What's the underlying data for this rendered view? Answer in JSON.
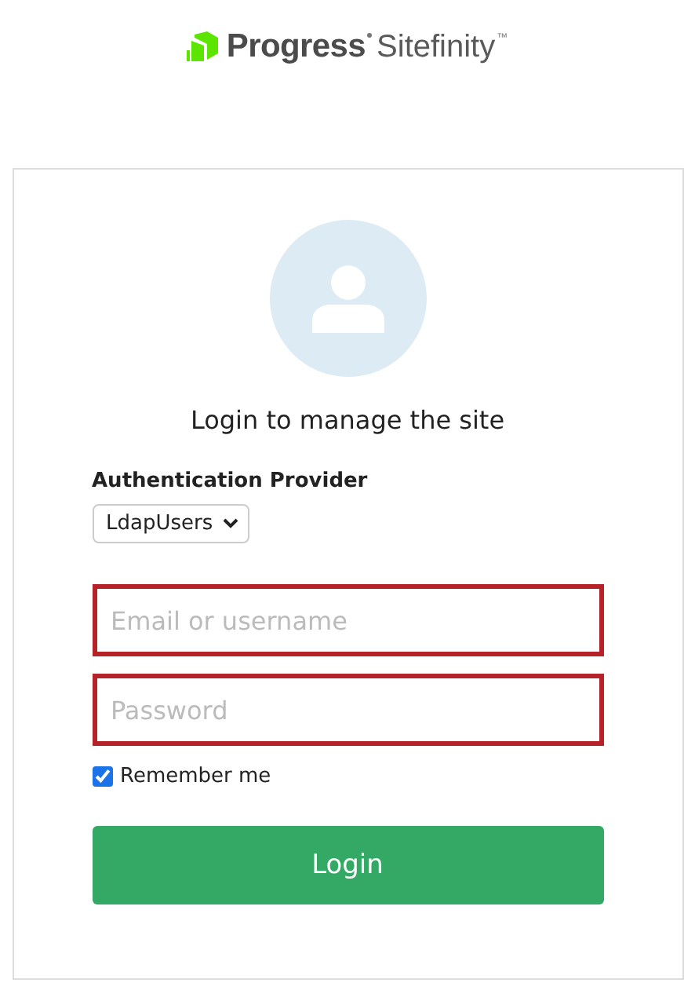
{
  "logo": {
    "brand": "Progress",
    "product": "Sitefinity",
    "mark": "™"
  },
  "login": {
    "title": "Login to manage the site",
    "provider": {
      "label": "Authentication Provider",
      "value": "LdapUsers"
    },
    "fields": [
      {
        "placeholder": "Email or username",
        "invalid": true
      },
      {
        "placeholder": "Password",
        "invalid": true
      }
    ],
    "remember": {
      "label": "Remember me",
      "checked": true
    },
    "button": "Login"
  }
}
